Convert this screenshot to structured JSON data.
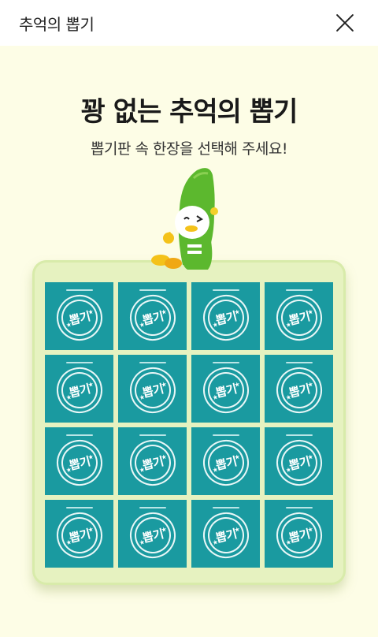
{
  "header": {
    "title": "추억의 뽑기"
  },
  "main": {
    "title": "꽝 없는 추억의 뽑기",
    "subtitle": "뽑기판 속 한장을 선택해 주세요!"
  },
  "board": {
    "tile_label": "뽑기",
    "tile_count": 16,
    "colors": {
      "tile": "#1a9aa0",
      "board": "#e6f2c0",
      "background": "#fdfde6"
    }
  },
  "icons": {
    "close": "close-icon",
    "mascot": "green-crocodile-mascot"
  }
}
